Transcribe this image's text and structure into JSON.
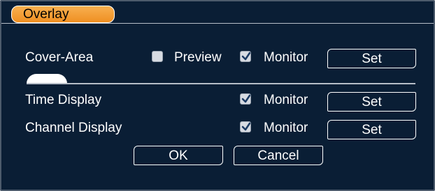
{
  "dialog": {
    "title": "Overlay"
  },
  "cover_area": {
    "label": "Cover-Area",
    "preview_label": "Preview",
    "preview_checked": false,
    "monitor_label": "Monitor",
    "monitor_checked": true,
    "set_label": "Set",
    "slider_level": 0
  },
  "time_display": {
    "label": "Time Display",
    "monitor_label": "Monitor",
    "monitor_checked": true,
    "set_label": "Set"
  },
  "channel_display": {
    "label": "Channel Display",
    "monitor_label": "Monitor",
    "monitor_checked": true,
    "set_label": "Set"
  },
  "actions": {
    "ok_label": "OK",
    "cancel_label": "Cancel"
  },
  "colors": {
    "background": "#0a1e35",
    "title_tab": "#f4a23c",
    "text": "#ffffff"
  }
}
